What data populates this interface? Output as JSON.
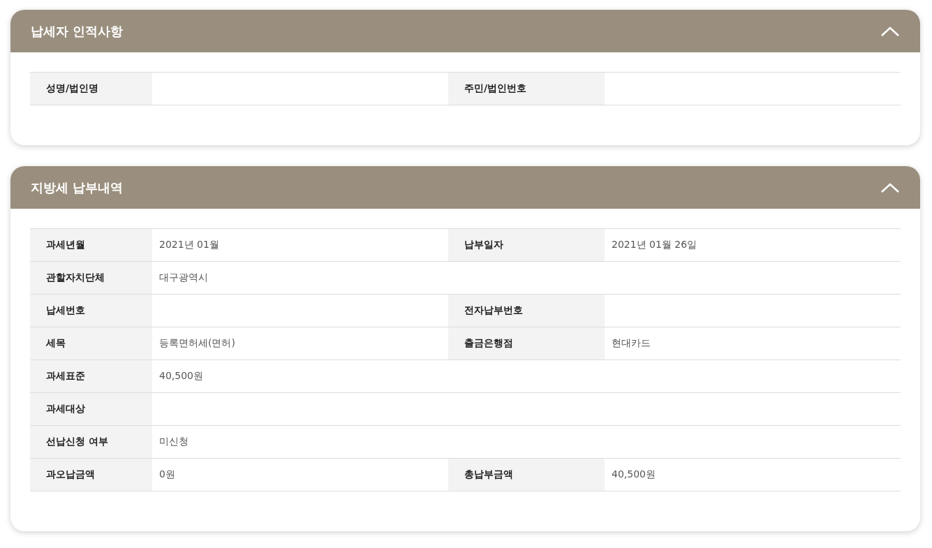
{
  "sections": [
    {
      "title": "납세자 인적사항",
      "expanded": true,
      "rows": [
        [
          {
            "label": "성명/법인명"
          },
          {
            "label": "주민/법인번호"
          }
        ]
      ]
    },
    {
      "title": "지방세 납부내역",
      "expanded": true,
      "rows": [
        [
          {
            "label": "과세년월",
            "value": "2021년 01월"
          },
          {
            "label": "납부일자",
            "value": "2021년 01월 26일"
          }
        ],
        [
          {
            "label": "관할자치단체",
            "value": "대구광역시"
          }
        ],
        [
          {
            "label": "납세번호"
          },
          {
            "label": "전자납부번호"
          }
        ],
        [
          {
            "label": "세목",
            "value": "등록면허세(면허)"
          },
          {
            "label": "출금은행점",
            "value": "현대카드"
          }
        ],
        [
          {
            "label": "과세표준",
            "value": "40,500원"
          }
        ],
        [
          {
            "label": "과세대상"
          }
        ],
        [
          {
            "label": "선납신청 여부",
            "value": "미신청"
          }
        ],
        [
          {
            "label": "과오납금액",
            "value": "0원"
          },
          {
            "label": "총납부금액",
            "value": "40,500원"
          }
        ]
      ]
    }
  ]
}
